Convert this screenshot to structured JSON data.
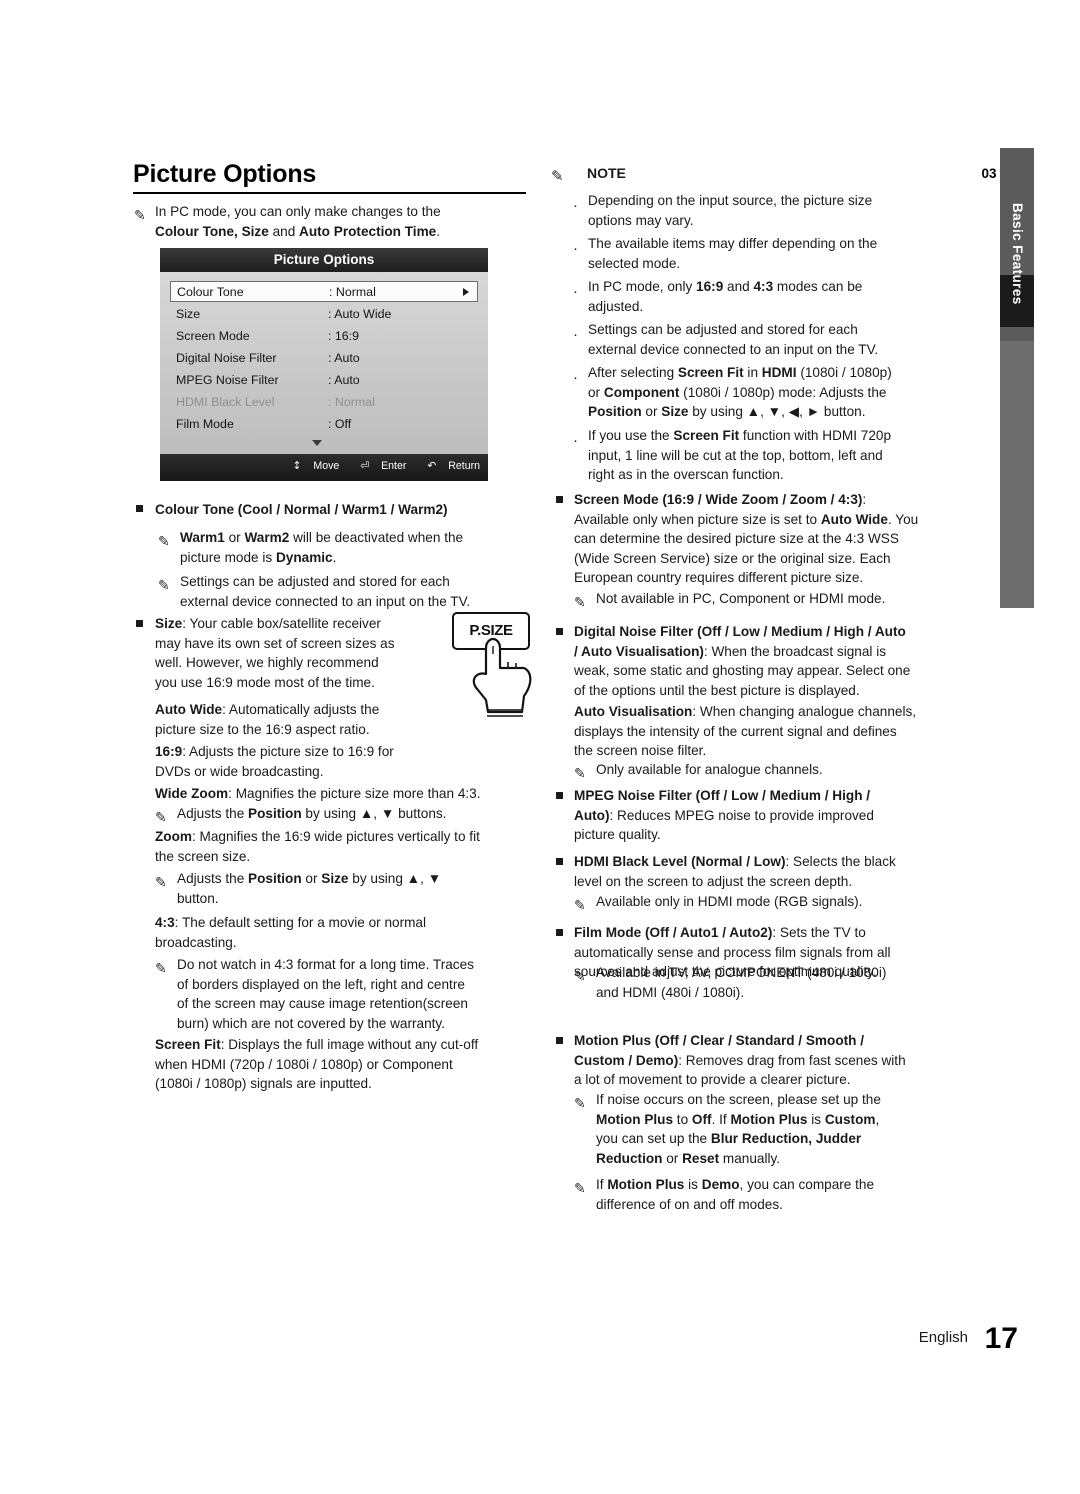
{
  "side_tab": {
    "number": "03",
    "label": "Basic Features"
  },
  "left": {
    "title": "Picture Options",
    "intro": {
      "glyph": "note-pencil-icon",
      "line1": "In PC mode, you can only make changes to the",
      "line2_a": "Colour Tone, Size",
      "line2_b": " and ",
      "line2_c": "Auto Protection Time",
      "line2_d": "."
    },
    "osd": {
      "title": "Picture Options",
      "rows": [
        {
          "label": "Colour Tone",
          "value": ": Normal",
          "selected": true,
          "dim": false,
          "arrow": true
        },
        {
          "label": "Size",
          "value": ": Auto Wide",
          "selected": false,
          "dim": false,
          "arrow": false
        },
        {
          "label": "Screen Mode",
          "value": ": 16:9",
          "selected": false,
          "dim": false,
          "arrow": false
        },
        {
          "label": "Digital Noise Filter",
          "value": ": Auto",
          "selected": false,
          "dim": false,
          "arrow": false
        },
        {
          "label": "MPEG Noise Filter",
          "value": ": Auto",
          "selected": false,
          "dim": false,
          "arrow": false
        },
        {
          "label": "HDMI Black Level",
          "value": ": Normal",
          "selected": false,
          "dim": true,
          "arrow": false
        },
        {
          "label": "Film Mode",
          "value": ": Off",
          "selected": false,
          "dim": false,
          "arrow": false
        }
      ],
      "footer": [
        {
          "icon": "↕",
          "label": "Move"
        },
        {
          "icon": "⏎",
          "label": "Enter"
        },
        {
          "icon": "↶",
          "label": "Return"
        }
      ]
    },
    "colour_tone": {
      "heading": "Colour Tone (Cool / Normal / Warm1 / Warm2)",
      "note1_a": "Warm1",
      "note1_b": " or ",
      "note1_c": "Warm2",
      "note1_d": " will be deactivated when the",
      "note1_e": "picture mode is ",
      "note1_f": "Dynamic",
      "note1_g": ".",
      "note2_l1": "Settings can be adjusted and stored for each",
      "note2_l2": "external device connected to an input on the TV."
    },
    "size": {
      "heading_a": "Size",
      "heading_b": ": Your cable box/satellite receiver",
      "l2": "may have its own set of screen sizes as",
      "l3": "well. However, we highly recommend",
      "l4": "you use 16:9 mode most of the time.",
      "auto_wide_a": "Auto Wide",
      "auto_wide_b": ": Automatically adjusts the",
      "auto_wide_l2": "picture size to the 16:9 aspect ratio.",
      "r169_a": "16:9",
      "r169_b": ": Adjusts the picture size to 16:9 for",
      "r169_l2": "DVDs or wide broadcasting.",
      "wide_zoom_a": "Wide Zoom",
      "wide_zoom_b": ": Magnifies the picture size more than 4:3.",
      "wide_zoom_note_a": "Adjusts the ",
      "wide_zoom_note_b": "Position",
      "wide_zoom_note_c": " by using ▲, ▼ buttons.",
      "zoom_a": "Zoom",
      "zoom_b": ": Magnifies the 16:9 wide pictures vertically to fit",
      "zoom_l2": "the screen size.",
      "zoom_note_a": "Adjusts the ",
      "zoom_note_b": "Position",
      "zoom_note_c": " or ",
      "zoom_note_d": "Size",
      "zoom_note_e": " by using ▲, ▼",
      "zoom_note_f": "button.",
      "r43_a": "4:3",
      "r43_b": ": The default setting for a movie or normal",
      "r43_l2": "broadcasting.",
      "r43_note_l1": "Do not watch in 4:3 format for a long time. Traces",
      "r43_note_l2": "of borders displayed on the left, right and centre",
      "r43_note_l3": "of the screen may cause image retention(screen",
      "r43_note_l4": "burn) which are not covered by the warranty.",
      "screen_fit_a": "Screen Fit",
      "screen_fit_b": ": Displays the full image without any cut-off",
      "screen_fit_l2": "when HDMI (720p / 1080i / 1080p) or Component",
      "screen_fit_l3": "(1080i / 1080p) signals are inputted."
    },
    "psize_button": {
      "label": "P.SIZE",
      "icon": "hand-pointer-icon"
    }
  },
  "right": {
    "note_title": "NOTE",
    "note_icon": "note-pencil-icon",
    "notes": [
      [
        "Depending on the input source, the picture size",
        "options may vary."
      ],
      [
        "The available items may differ depending on the",
        "selected mode."
      ],
      [
        "In PC mode, only 16:9 and 4:3 modes can be",
        "adjusted."
      ],
      [
        "Settings can be adjusted and stored for each",
        "external device connected to an input on the TV."
      ],
      [
        "After selecting Screen Fit in HDMI (1080i / 1080p)",
        "or Component (1080i / 1080p) mode: Adjusts the",
        "Position or Size by using ▲, ▼, ◀, ▶ button."
      ],
      [
        "If you use the Screen Fit function with HDMI 720p",
        "input, 1 line will be cut at the top, bottom, left and",
        "right as in the overscan function."
      ]
    ],
    "screen_mode": {
      "heading": "Screen Mode (16:9 / Wide Zoom / Zoom / 4:3)",
      "colon": ":",
      "l1_a": "Available only when picture size is set to ",
      "l1_b": "Auto Wide",
      "l1_c": ". You",
      "l2": "can determine the desired picture size at the 4:3 WSS",
      "l3": "(Wide Screen Service) size or the original size. Each",
      "l4": "European country requires different picture size.",
      "note": "Not available in PC, Component or HDMI mode."
    },
    "dnf": {
      "heading_a": "Digital Noise Filter (Off / Low / Medium / High / Auto",
      "heading_b": "/ Auto Visualisation)",
      "heading_c": ": When the broadcast signal is",
      "l3": "weak, some static and ghosting may appear. Select one",
      "l4": "of the options until the best picture is displayed.",
      "av_a": "Auto Visualisation",
      "av_b": ": When changing analogue channels,",
      "av_l2": "displays the intensity of the current signal and defines",
      "av_l3": "the screen noise filter.",
      "note": "Only available for analogue channels."
    },
    "mpeg": {
      "heading_a": "MPEG Noise Filter (Off / Low / Medium / High /",
      "heading_b": "Auto)",
      "heading_c": ": Reduces MPEG noise to provide improved",
      "l3": "picture quality."
    },
    "hdmi_black": {
      "heading_a": "HDMI Black Level (Normal / Low)",
      "heading_b": ": Selects the black",
      "l2": "level on the screen to adjust the screen depth.",
      "note": "Available only in HDMI mode (RGB signals)."
    },
    "film_mode": {
      "heading_a": "Film Mode (Off / Auto1 / Auto2)",
      "heading_b": ": Sets the TV to",
      "l2": "automatically sense and process film signals from all",
      "l3": "sources and adjust the picture for optimum quality.",
      "note_l1": "Available in TV, AV, COMPONENT (480i / 1080i)",
      "note_l2": "and HDMI (480i / 1080i)."
    },
    "motion_plus": {
      "heading_a": "Motion Plus (Off / Clear / Standard / Smooth /",
      "heading_b": "Custom / Demo)",
      "heading_c": ": Removes drag from fast scenes with",
      "l3": "a lot of movement to provide a clearer picture.",
      "note1_l1": "If noise occurs on the screen, please set up the",
      "note1_l2_a": "Motion Plus",
      "note1_l2_b": " to ",
      "note1_l2_c": "Off",
      "note1_l2_d": ". If ",
      "note1_l2_e": "Motion Plus",
      "note1_l2_f": " is ",
      "note1_l2_g": "Custom",
      "note1_l2_h": ",",
      "note1_l3_a": "you can set up the ",
      "note1_l3_b": "Blur Reduction, Judder",
      "note1_l4_a": "Reduction",
      "note1_l4_b": " or ",
      "note1_l4_c": "Reset",
      "note1_l4_d": " manually.",
      "note2_l1_a": "If ",
      "note2_l1_b": "Motion Plus",
      "note2_l1_c": " is ",
      "note2_l1_d": "Demo",
      "note2_l1_e": ", you can compare the",
      "note2_l2": "difference of on and off modes."
    }
  },
  "footer": {
    "language": "English",
    "page": "17"
  }
}
